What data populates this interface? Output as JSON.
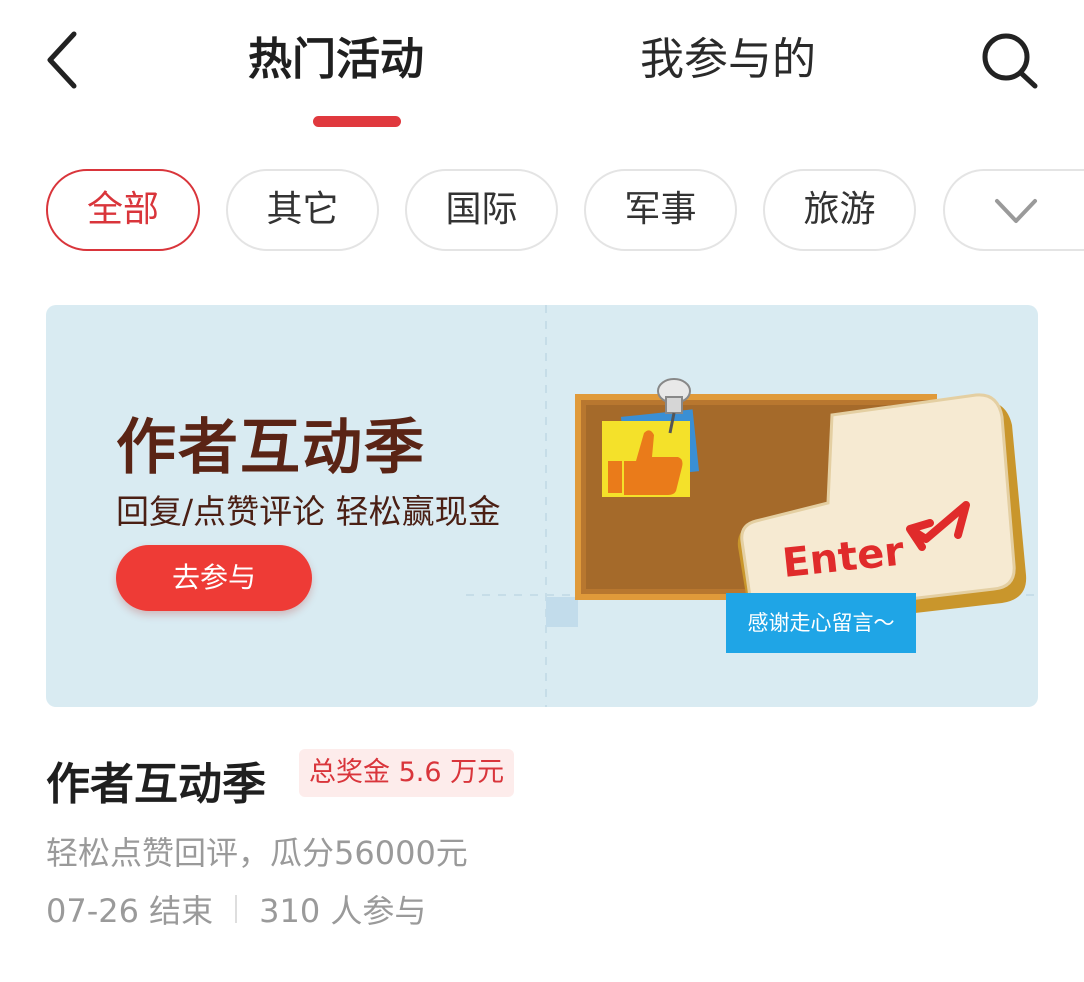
{
  "header": {
    "tabs": [
      {
        "label": "热门活动",
        "active": true
      },
      {
        "label": "我参与的",
        "active": false
      }
    ],
    "back_icon": "chevron-left-icon",
    "search_icon": "search-icon",
    "accent_color": "#e0393e"
  },
  "categories": {
    "items": [
      {
        "label": "全部",
        "active": true
      },
      {
        "label": "其它",
        "active": false
      },
      {
        "label": "国际",
        "active": false
      },
      {
        "label": "军事",
        "active": false
      },
      {
        "label": "旅游",
        "active": false
      }
    ],
    "more_icon": "chevron-down-icon"
  },
  "banner": {
    "title": "作者互动季",
    "subtitle": "回复/点赞评论 轻松赢现金",
    "cta": "去参与",
    "key_label": "Enter",
    "note": "感谢走心留言～"
  },
  "activity": {
    "title": "作者互动季",
    "prize": "总奖金 5.6 万元",
    "description": "轻松点赞回评，瓜分56000元",
    "end_date": "07-26 结束",
    "participants": "310 人参与"
  }
}
